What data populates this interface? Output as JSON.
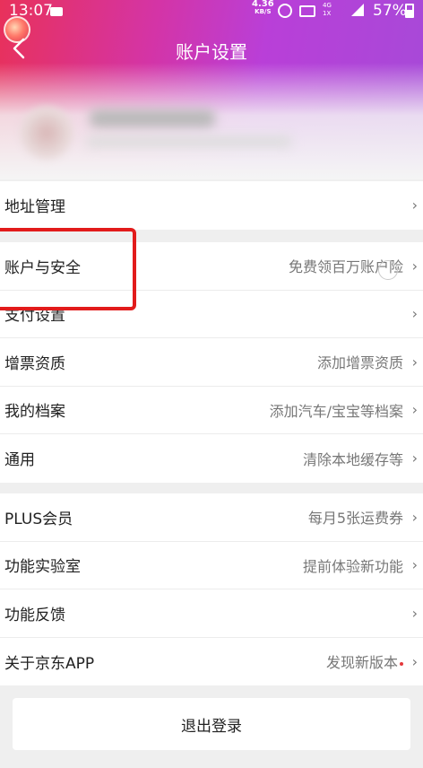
{
  "status_bar": {
    "time": "13:07",
    "speed_value": "4.36",
    "speed_unit": "KB/S",
    "network_top": "4G",
    "network_bottom": "1X",
    "battery": "57%"
  },
  "header": {
    "title": "账户设置",
    "back_icon": "chevron-left-icon"
  },
  "groups": {
    "g1": [
      {
        "label": "地址管理",
        "value": ""
      }
    ],
    "g2": [
      {
        "label": "账户与安全",
        "value": "免费领百万账户险"
      },
      {
        "label": "支付设置",
        "value": ""
      },
      {
        "label": "增票资质",
        "value": "添加增票资质"
      },
      {
        "label": "我的档案",
        "value": "添加汽车/宝宝等档案"
      },
      {
        "label": "通用",
        "value": "清除本地缓存等"
      }
    ],
    "g3": [
      {
        "label": "PLUS会员",
        "value": "每月5张运费券"
      },
      {
        "label": "功能实验室",
        "value": "提前体验新功能"
      },
      {
        "label": "功能反馈",
        "value": ""
      },
      {
        "label": "关于京东APP",
        "value": "发现新版本"
      }
    ]
  },
  "chevron": "›",
  "logout_label": "退出登录",
  "colors": {
    "highlight": "#e21b1b",
    "gradient_start": "#e8315a",
    "gradient_end": "#a64ad8",
    "new_version_dot": "#e4393c"
  }
}
